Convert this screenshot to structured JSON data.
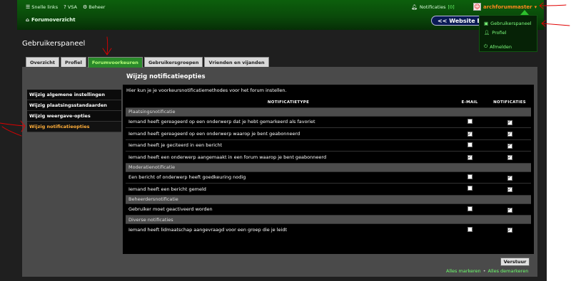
{
  "nav": {
    "links": [
      {
        "label": "Snelle links",
        "icon": "menu-icon"
      },
      {
        "label": "VSA",
        "icon": "help-icon"
      },
      {
        "label": "Beheer",
        "icon": "gear-icon"
      }
    ],
    "notifications_label": "Notificaties",
    "notifications_count": "[0]",
    "username": "archforummaster",
    "breadcrumb": "Forumoverzicht",
    "site_button": "<< Website Euro"
  },
  "user_menu": {
    "items": [
      {
        "label": "Gebruikerspaneel",
        "icon": "control-panel-icon"
      },
      {
        "label": "Profiel",
        "icon": "user-icon"
      },
      {
        "label": "Afmelden",
        "icon": "power-icon"
      }
    ]
  },
  "page": {
    "title": "Gebruikerspaneel",
    "tabs": [
      "Overzicht",
      "Profiel",
      "Forumvoorkeuren",
      "Gebruikersgroepen",
      "Vrienden en vijanden"
    ],
    "active_tab": "Forumvoorkeuren"
  },
  "sidebar": {
    "items": [
      "Wijzig algemene instellingen",
      "Wijzig plaatsingsstandaarden",
      "Wijzig weergave-opties",
      "Wijzig notificatieopties"
    ],
    "active": "Wijzig notificatieopties"
  },
  "content": {
    "title": "Wijzig notificatieopties",
    "intro": "Hier kun je je voorkeursnotificatiemethodes voor het forum instellen.",
    "columns": [
      "NOTIFICATIETYPE",
      "E-MAIL",
      "NOTIFICATIES"
    ],
    "sections": [
      {
        "name": "Plaatsingsnotificatie",
        "rows": [
          {
            "label": "Iemand heeft gereageerd op een onderwerp dat je hebt gemarkeerd als favoriet",
            "email": false,
            "notif": true
          },
          {
            "label": "Iemand heeft gereageerd op een onderwerp waarop je bent geabonneerd",
            "email": true,
            "notif": true
          },
          {
            "label": "Iemand heeft je geciteerd in een bericht",
            "email": false,
            "notif": true
          },
          {
            "label": "Iemand heeft een onderwerp aangemaakt in een forum waarop je bent geabonneerd",
            "email": true,
            "notif": true
          }
        ]
      },
      {
        "name": "Moderatienotificatie",
        "rows": [
          {
            "label": "Een bericht of onderwerp heeft goedkeuring nodig",
            "email": false,
            "notif": true
          },
          {
            "label": "Iemand heeft een bericht gemeld",
            "email": false,
            "notif": true
          }
        ]
      },
      {
        "name": "Beheerdersnotificatie",
        "rows": [
          {
            "label": "Gebruiker moet geactiveerd worden",
            "email": false,
            "notif": true
          }
        ]
      },
      {
        "name": "Diverse notificaties",
        "rows": [
          {
            "label": "Iemand heeft lidmaatschap aangevraagd voor een groep die je leidt",
            "email": false,
            "notif": true
          }
        ]
      }
    ],
    "submit": "Verstuur",
    "mark_all": "Alles markeren",
    "separator": "•",
    "unmark_all": "Alles demarkeren"
  },
  "colors": {
    "navbar": "#0a4a0a",
    "accent_green": "#6cff6c",
    "active_orange": "#ffae3a",
    "annotation_red": "#e00000"
  }
}
